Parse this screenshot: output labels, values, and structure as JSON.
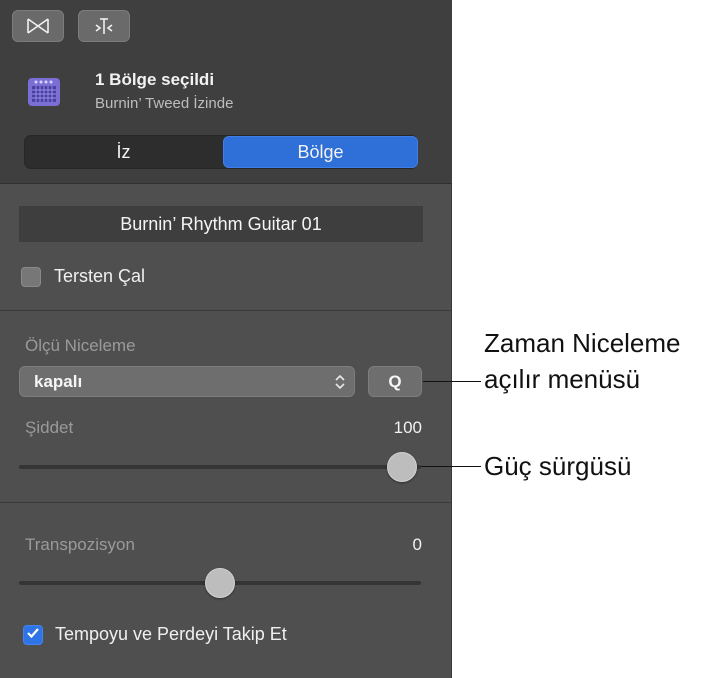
{
  "toolbar": {
    "icons": [
      "loop-icon",
      "split-icon"
    ]
  },
  "header": {
    "title": "1 Bölge seçildi",
    "subtitle": "Burnin’ Tweed İzinde"
  },
  "segments": {
    "left": "İz",
    "right": "Bölge",
    "selected": "Bölge"
  },
  "region": {
    "name": "Burnin’ Rhythm Guitar 01",
    "reverse_label": "Tersten Çal",
    "reverse_checked": false
  },
  "quantize": {
    "label": "Ölçü Niceleme",
    "value": "kapalı",
    "q_label": "Q"
  },
  "strength": {
    "label": "Şiddet",
    "value": "100",
    "fraction": 1.0
  },
  "transpose": {
    "label": "Transpozisyon",
    "value": "0",
    "fraction": 0.5
  },
  "follow": {
    "label": "Tempoyu ve Perdeyi Takip Et",
    "checked": true
  },
  "callouts": {
    "quantize_line1": "Zaman Niceleme",
    "quantize_line2": "açılır menüsü",
    "strength": "Güç sürgüsü"
  },
  "colors": {
    "accent": "#2e6fd8"
  }
}
